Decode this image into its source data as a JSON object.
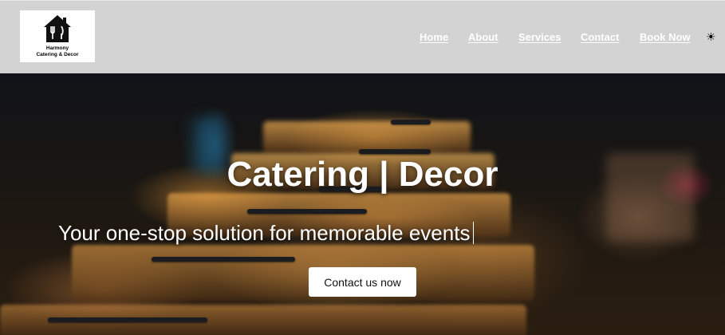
{
  "logo": {
    "icon": "house-fork-icon",
    "line1": "Harmony",
    "line2": "Catering & Decor"
  },
  "nav": {
    "items": [
      {
        "label": "Home"
      },
      {
        "label": "About"
      },
      {
        "label": "Services"
      },
      {
        "label": "Contact"
      },
      {
        "label": "Book Now"
      }
    ],
    "theme_toggle_icon": "sun-icon",
    "theme_toggle_glyph": "☀"
  },
  "hero": {
    "title": "Catering | Decor",
    "subtitle": "Your one-stop solution for memorable events",
    "cta_label": "Contact us now",
    "background_image": "chafing-dishes-photo"
  },
  "colors": {
    "navbar_bg": "#d3d3d3",
    "nav_text": "#ffffff",
    "cta_bg": "#ffffff"
  }
}
